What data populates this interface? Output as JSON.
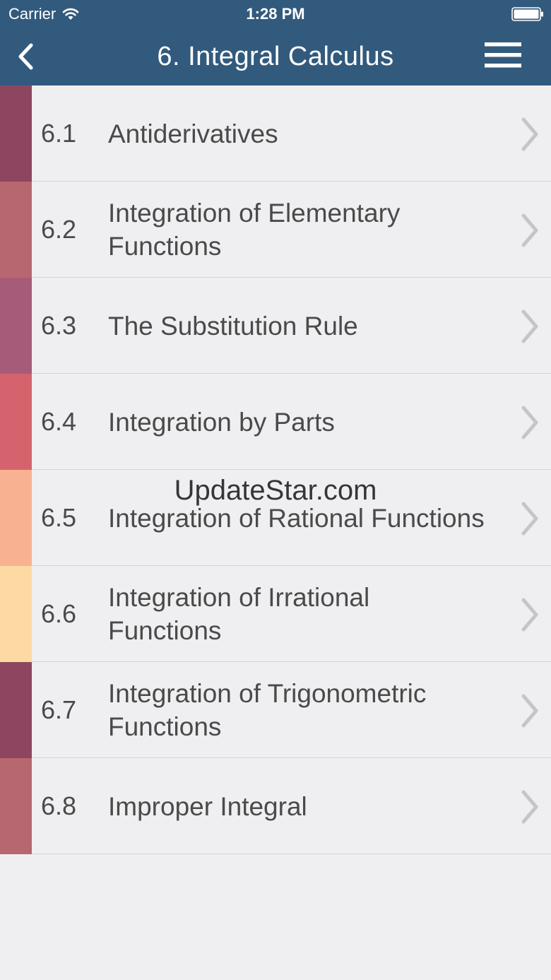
{
  "status_bar": {
    "carrier": "Carrier",
    "time": "1:28 PM",
    "wifi_icon": "wifi-icon",
    "battery_icon": "battery-icon"
  },
  "nav": {
    "title": "6. Integral Calculus",
    "back_icon": "chevron-left-icon",
    "menu_icon": "hamburger-menu-icon"
  },
  "items": [
    {
      "number": "6.1",
      "title": "Antiderivatives",
      "color": "#8e4660"
    },
    {
      "number": "6.2",
      "title": "Integration of Elementary Functions",
      "color": "#b7676f"
    },
    {
      "number": "6.3",
      "title": "The Substitution Rule",
      "color": "#a65c79"
    },
    {
      "number": "6.4",
      "title": "Integration by Parts",
      "color": "#d5636d"
    },
    {
      "number": "6.5",
      "title": "Integration of Rational Functions",
      "color": "#f8b291"
    },
    {
      "number": "6.6",
      "title": "Integration of Irrational Functions",
      "color": "#fdd9a4"
    },
    {
      "number": "6.7",
      "title": "Integration of Trigonometric Functions",
      "color": "#8e4660"
    },
    {
      "number": "6.8",
      "title": "Improper Integral",
      "color": "#b7676f"
    }
  ],
  "watermark": "UpdateStar.com",
  "colors": {
    "header": "#325a7d",
    "background": "#efeff1",
    "text": "#4a4a4a",
    "chevron": "#c5c5c9"
  }
}
